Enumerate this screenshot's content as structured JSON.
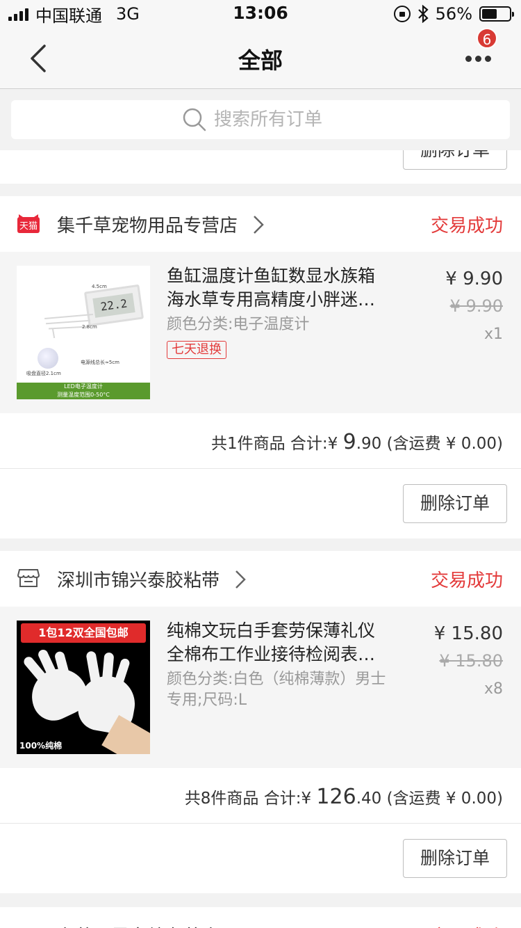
{
  "status_bar": {
    "carrier": "中国联通",
    "network": "3G",
    "time": "13:06",
    "battery": "56%",
    "battery_level": 0.56
  },
  "nav": {
    "title": "全部",
    "badge_count": "6"
  },
  "search": {
    "placeholder": "搜索所有订单"
  },
  "orders": [
    {
      "shop_name": "集千草宠物用品专营店",
      "shop_type": "天猫",
      "status": "交易成功",
      "item": {
        "title_line1": "鱼缸温度计鱼缸数显水族箱",
        "title_line2": "海水草专用高精度小胖迷…",
        "sku": "颜色分类:电子温度计",
        "tag": "七天退换",
        "price": "¥ 9.90",
        "original_price": "¥ 9.90",
        "qty": "x1",
        "image_text": {
          "display": "22.2",
          "bar_line1": "LED电子温度计",
          "bar_line2": "测量温度范围0-50°C",
          "dim1": "4.5cm",
          "dim2": "2.8cm",
          "cable": "电源线总长≈5cm",
          "suction": "吸盘直径2.1cm"
        }
      },
      "summary": {
        "count_text": "共1件商品 合计:",
        "currency": "¥",
        "total_int": "9",
        "total_dec": ".90",
        "shipping": "(含运费 ¥ 0.00)"
      },
      "action_label": "删除订单"
    },
    {
      "shop_name": "深圳市锦兴泰胶粘带",
      "shop_type": "store",
      "status": "交易成功",
      "item": {
        "title_line1": "纯棉文玩白手套劳保薄礼仪",
        "title_line2": "全棉布工作业接待检阅表…",
        "sku": "颜色分类:白色（纯棉薄款）男士专用;尺码:L",
        "price": "¥ 15.80",
        "original_price": "¥ 15.80",
        "qty": "x8",
        "image_text": {
          "banner": "1包12双全国包邮",
          "footer": "100%纯棉"
        }
      },
      "summary": {
        "count_text": "共8件商品 合计:",
        "currency": "¥",
        "total_int": "126",
        "total_dec": ".40",
        "shipping": "(含运费 ¥ 0.00)"
      },
      "action_label": "删除订单"
    }
  ],
  "top_partial": {
    "action_label": "删除订单"
  },
  "bottom_partial": {
    "shop_name": "东莞国恩文绩有茶店",
    "status": "交易成功"
  }
}
